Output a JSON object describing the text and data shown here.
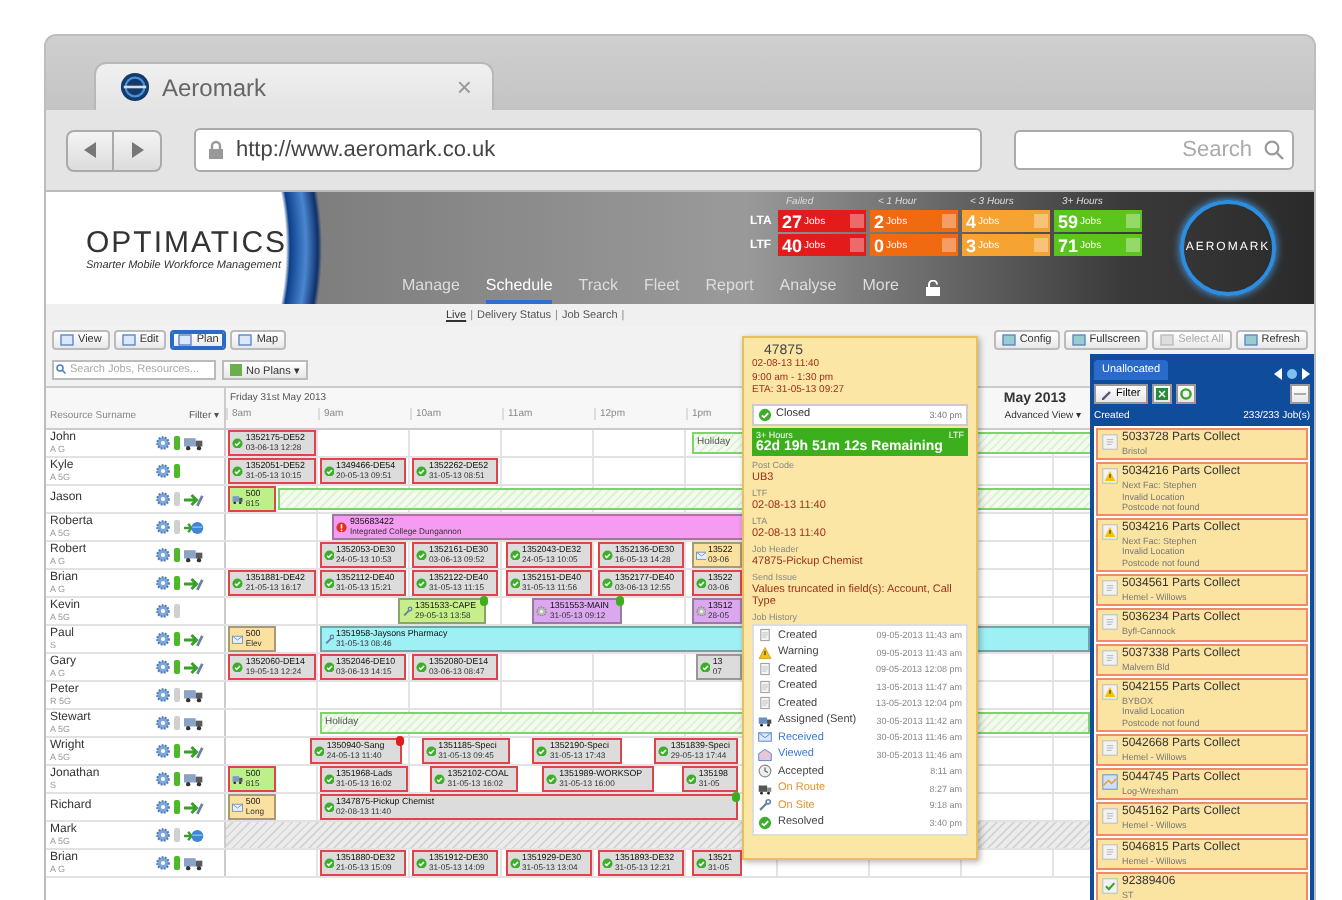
{
  "browser": {
    "tab": {
      "title": "Aeromark",
      "close": "×"
    },
    "url": "http://www.aeromark.co.uk",
    "search": {
      "placeholder": "Search"
    }
  },
  "header": {
    "logo": {
      "name": "OPTIMATICS",
      "tagline": "Smarter Mobile Workforce Management"
    },
    "brand": "AEROMARK",
    "stats": {
      "columns": [
        "Failed",
        "< 1 Hour",
        "< 3 Hours",
        "3+ Hours"
      ],
      "rows": [
        {
          "label": "LTA",
          "cells": [
            {
              "count": "27",
              "unit": "Jobs",
              "color": "#e31b1b"
            },
            {
              "count": "2",
              "unit": "Jobs",
              "color": "#f06a12"
            },
            {
              "count": "4",
              "unit": "Jobs",
              "color": "#f5a332"
            },
            {
              "count": "59",
              "unit": "Jobs",
              "color": "#5cc51d"
            }
          ]
        },
        {
          "label": "LTF",
          "cells": [
            {
              "count": "40",
              "unit": "Jobs",
              "color": "#e31b1b"
            },
            {
              "count": "0",
              "unit": "Jobs",
              "color": "#f06a12"
            },
            {
              "count": "3",
              "unit": "Jobs",
              "color": "#f5a332"
            },
            {
              "count": "71",
              "unit": "Jobs",
              "color": "#5cc51d"
            }
          ]
        }
      ]
    },
    "nav": [
      {
        "label": "Manage",
        "selected": false
      },
      {
        "label": "Schedule",
        "selected": true
      },
      {
        "label": "Track",
        "selected": false
      },
      {
        "label": "Fleet",
        "selected": false
      },
      {
        "label": "Report",
        "selected": false
      },
      {
        "label": "Analyse",
        "selected": false
      },
      {
        "label": "More",
        "selected": false
      }
    ],
    "subnav": [
      {
        "label": "Live",
        "selected": true,
        "separator": "|"
      },
      {
        "label": "Delivery Status",
        "selected": false,
        "separator": "|"
      },
      {
        "label": "Job Search",
        "selected": false,
        "separator": "|"
      }
    ]
  },
  "toolbar": {
    "views": [
      {
        "label": "View",
        "selected": false
      },
      {
        "label": "Edit",
        "selected": false
      },
      {
        "label": "Plan",
        "selected": true
      },
      {
        "label": "Map",
        "selected": false
      }
    ],
    "actions": [
      {
        "label": "Config",
        "disabled": false
      },
      {
        "label": "Fullscreen",
        "disabled": false
      },
      {
        "label": "Select All",
        "disabled": true
      },
      {
        "label": "Refresh",
        "disabled": false
      }
    ]
  },
  "search": {
    "placeholder": "Search Jobs, Resources...",
    "plans": "No Plans ▾"
  },
  "schedule": {
    "date": "Friday 31st May 2013",
    "resource_header": "Resource Surname",
    "filter": "Filter ▾",
    "month": "May 2013",
    "view": "Advanced View ▾",
    "hours": [
      "8am",
      "9am",
      "10am",
      "11am",
      "12pm",
      "1pm"
    ],
    "rows": [
      {
        "name": "John",
        "sub": "A G",
        "phone": true,
        "kind": "truck",
        "jobs": [
          {
            "kind": "check",
            "color": "#dcdcdc",
            "late": true,
            "id": "1352175-DE52",
            "time": "03-06-13 12:28"
          },
          {
            "kind": "holiday",
            "label": "Holiday"
          }
        ]
      },
      {
        "name": "Kyle",
        "sub": "A 5G",
        "phone": true,
        "kind": "none",
        "jobs": [
          {
            "kind": "check",
            "color": "#dcdcdc",
            "late": true,
            "id": "1352051-DE52",
            "time": "31-05-13 10:15"
          },
          {
            "kind": "check",
            "color": "#dcdcdc",
            "late": true,
            "id": "1349466-DE54",
            "time": "20-05-13 09:51"
          },
          {
            "kind": "check",
            "color": "#dcdcdc",
            "late": true,
            "id": "1352262-DE52",
            "time": "31-05-13 08:51"
          }
        ]
      },
      {
        "name": "Jason",
        "phone": false,
        "kind": "arrow",
        "jobs": [
          {
            "kind": "truck",
            "color": "#bdf08a",
            "late": true,
            "id": "500",
            "time": "815"
          },
          {
            "kind": "holiday"
          }
        ]
      },
      {
        "name": "Roberta",
        "sub": "A 5G",
        "phone": false,
        "kind": "globe",
        "jobs": [
          {
            "kind": "alert",
            "color": "#f59cf2",
            "late": false,
            "id": "935683422",
            "time": "Integrated College Dungannon"
          }
        ]
      },
      {
        "name": "Robert",
        "sub": "A G",
        "phone": true,
        "kind": "truck",
        "jobs": [
          {
            "kind": "check",
            "color": "#dcdcdc",
            "late": true,
            "id": "1352053-DE30",
            "time": "24-05-13 10:53"
          },
          {
            "kind": "check",
            "color": "#dcdcdc",
            "late": true,
            "id": "1352161-DE30",
            "time": "03-06-13 09:52"
          },
          {
            "kind": "check",
            "color": "#dcdcdc",
            "late": true,
            "id": "1352043-DE32",
            "time": "24-05-13 10:05"
          },
          {
            "kind": "check",
            "color": "#dcdcdc",
            "late": true,
            "id": "1352136-DE30",
            "time": "16-05-13 14:28"
          },
          {
            "kind": "mail",
            "color": "#fbe1a0",
            "late": false,
            "id": "13522",
            "time": "03-06"
          }
        ]
      },
      {
        "name": "Brian",
        "sub": "A G",
        "phone": true,
        "kind": "arrow",
        "jobs": [
          {
            "kind": "check",
            "color": "#dcdcdc",
            "late": true,
            "id": "1351881-DE42",
            "time": "21-05-13 16:17"
          },
          {
            "kind": "check",
            "color": "#dcdcdc",
            "late": true,
            "id": "1352112-DE40",
            "time": "31-05-13 15:21"
          },
          {
            "kind": "check",
            "color": "#dcdcdc",
            "late": true,
            "id": "1352122-DE40",
            "time": "31-05-13 11:15"
          },
          {
            "kind": "check",
            "color": "#dcdcdc",
            "late": true,
            "id": "1352151-DE40",
            "time": "31-05-13 11:56"
          },
          {
            "kind": "check",
            "color": "#dcdcdc",
            "late": true,
            "id": "1352177-DE40",
            "time": "03-06-13 12:55"
          },
          {
            "kind": "check",
            "color": "#dcdcdc",
            "late": true,
            "id": "13522",
            "time": "03-06"
          }
        ]
      },
      {
        "name": "Kevin",
        "sub": "A 5G",
        "phone": false,
        "kind": "none",
        "jobs": [
          {
            "kind": "wrench",
            "color": "#c6ef8c",
            "late": false,
            "id": "1351533-CAPE",
            "time": "29-05-13 13:58",
            "badge": {
              "color": "#3cb01c"
            }
          },
          {
            "kind": "gear",
            "color": "#dba8f0",
            "late": false,
            "id": "1351553-MAIN",
            "time": "31-05-13 09:12",
            "badge": {
              "color": "#3cb01c"
            }
          },
          {
            "kind": "gear",
            "color": "#dba8f0",
            "late": false,
            "id": "13512",
            "time": "28-05"
          }
        ]
      },
      {
        "name": "Paul",
        "sub": "S",
        "phone": true,
        "kind": "arrow",
        "jobs": [
          {
            "kind": "mail",
            "color": "#fbe1a0",
            "late": false,
            "id": "500",
            "time": "Elev"
          },
          {
            "kind": "wrench",
            "color": "#9ff0f4",
            "late": false,
            "id": "1351958-Jaysons Pharmacy",
            "time": "31-05-13 08:46"
          }
        ]
      },
      {
        "name": "Gary",
        "sub": "A G",
        "phone": true,
        "kind": "arrow",
        "jobs": [
          {
            "kind": "check",
            "color": "#dcdcdc",
            "late": true,
            "id": "1352060-DE14",
            "time": "19-05-13 12:24"
          },
          {
            "kind": "check",
            "color": "#dcdcdc",
            "late": true,
            "id": "1352046-DE10",
            "time": "03-06-13 14:15"
          },
          {
            "kind": "check",
            "color": "#dcdcdc",
            "late": true,
            "id": "1352080-DE14",
            "time": "03-06-13 08:47"
          },
          {
            "kind": "check",
            "color": "#dcdcdc",
            "late": false,
            "id": "13",
            "time": "07"
          }
        ]
      },
      {
        "name": "Peter",
        "sub": "R 5G",
        "phone": false,
        "kind": "truck",
        "jobs": []
      },
      {
        "name": "Stewart",
        "sub": "A 5G",
        "phone": false,
        "kind": "truck",
        "jobs": [
          {
            "kind": "holiday",
            "label": "Holiday"
          }
        ]
      },
      {
        "name": "Wright",
        "sub": "A 5G",
        "phone": true,
        "kind": "arrow",
        "jobs": [
          {
            "kind": "check",
            "color": "#dcdcdc",
            "late": true,
            "id": "1350940-Sang",
            "time": "24-05-13 11:40",
            "badge": {
              "color": "#e31b1b"
            }
          },
          {
            "kind": "check",
            "color": "#dcdcdc",
            "late": true,
            "id": "1351185-Speci",
            "time": "31-05-13 09:45"
          },
          {
            "kind": "check",
            "color": "#dcdcdc",
            "late": true,
            "id": "1352190-Speci",
            "time": "31-05-13 17:43"
          },
          {
            "kind": "check",
            "color": "#dcdcdc",
            "late": true,
            "id": "1351839-Speci",
            "time": "29-05-13 17:44"
          }
        ]
      },
      {
        "name": "Jonathan",
        "sub": "S",
        "phone": true,
        "kind": "truck",
        "jobs": [
          {
            "kind": "truck",
            "color": "#bdf08a",
            "late": true,
            "id": "500",
            "time": "815"
          },
          {
            "kind": "check",
            "color": "#dcdcdc",
            "late": true,
            "id": "1351968-Lads",
            "time": "31-05-13 16:02"
          },
          {
            "kind": "check",
            "color": "#dcdcdc",
            "late": true,
            "id": "1352102-COAL",
            "time": "31-05-13 16:02"
          },
          {
            "kind": "check",
            "color": "#dcdcdc",
            "late": true,
            "id": "1351989-WORKSOP",
            "time": "31-05-13 16:00"
          },
          {
            "kind": "check",
            "color": "#dcdcdc",
            "late": true,
            "id": "135198",
            "time": "31-05"
          }
        ]
      },
      {
        "name": "Richard",
        "phone": true,
        "kind": "arrow",
        "jobs": [
          {
            "kind": "mail",
            "color": "#fbe1a0",
            "late": false,
            "id": "500",
            "time": "Long"
          },
          {
            "kind": "check",
            "color": "#dcdcdc",
            "late": true,
            "id": "1347875-Pickup Chemist",
            "time": "02-08-13 11:40",
            "badge": {
              "color": "#3cb01c"
            }
          }
        ]
      },
      {
        "name": "Mark",
        "sub": "A 5G",
        "phone": false,
        "kind": "globe",
        "jobs": [
          {
            "kind": "blocked"
          }
        ]
      },
      {
        "name": "Brian",
        "sub": "A G",
        "phone": true,
        "kind": "truck",
        "jobs": [
          {
            "kind": "check",
            "color": "#dcdcdc",
            "late": true,
            "id": "1351880-DE32",
            "time": "21-05-13 15:09"
          },
          {
            "kind": "check",
            "color": "#dcdcdc",
            "late": true,
            "id": "1351912-DE30",
            "time": "31-05-13 14:09"
          },
          {
            "kind": "check",
            "color": "#dcdcdc",
            "late": true,
            "id": "1351929-DE30",
            "time": "31-05-13 13:04"
          },
          {
            "kind": "check",
            "color": "#dcdcdc",
            "late": true,
            "id": "1351893-DE32",
            "time": "31-05-13 12:21"
          },
          {
            "kind": "check",
            "color": "#dcdcdc",
            "late": true,
            "id": "13521",
            "time": "31-05"
          }
        ]
      }
    ]
  },
  "tooltip": {
    "job": "47875",
    "lines": [
      "02-08-13 11:40",
      "9:00 am - 1:30 pm",
      "ETA: 31-05-13 09:27"
    ],
    "status": {
      "label": "Closed",
      "time": "3:40 pm"
    },
    "sla": {
      "band": "3+ Hours",
      "type": "LTF",
      "remaining": "62d 19h 51m 12s Remaining"
    },
    "fields": [
      {
        "label": "Post Code",
        "value": "UB3"
      },
      {
        "label": "LTF",
        "value": "02-08-13 11:40"
      },
      {
        "label": "LTA",
        "value": "02-08-13 11:40"
      },
      {
        "label": "Job Header",
        "value": "47875-Pickup Chemist"
      },
      {
        "label": "Send Issue",
        "value": "Values truncated in field(s): Account, Call Type"
      }
    ],
    "history_title": "Job History",
    "history": [
      {
        "kind": "created",
        "label": "Created",
        "time": "09-05-2013 11:43 am"
      },
      {
        "kind": "warning",
        "label": "Warning",
        "time": "09-05-2013 11:43 am"
      },
      {
        "kind": "created",
        "label": "Created",
        "time": "09-05-2013 12:08 pm"
      },
      {
        "kind": "created",
        "label": "Created",
        "time": "13-05-2013 11:47 am"
      },
      {
        "kind": "created",
        "label": "Created",
        "time": "13-05-2013 12:04 pm"
      },
      {
        "kind": "assigned",
        "label": "Assigned (Sent)",
        "time": "30-05-2013 11:42 am"
      },
      {
        "kind": "received",
        "label": "Received",
        "time": "30-05-2013 11:46 am"
      },
      {
        "kind": "viewed",
        "label": "Viewed",
        "time": "30-05-2013 11:46 am"
      },
      {
        "kind": "accepted",
        "label": "Accepted",
        "time": "8:11 am"
      },
      {
        "kind": "onroute",
        "label": "On Route",
        "time": "8:27 am"
      },
      {
        "kind": "onsite",
        "label": "On Site",
        "time": "9:18 am"
      },
      {
        "kind": "resolved",
        "label": "Resolved",
        "time": "3:40 pm"
      }
    ]
  },
  "unallocated": {
    "tab": "Unallocated",
    "filter": "Filter",
    "sort": "Created",
    "count": "233/233 Job(s)",
    "items": [
      {
        "kind": "doc",
        "title": "5033728 Parts Collect",
        "lines": [
          "Bristol"
        ]
      },
      {
        "kind": "warning",
        "title": "5034216 Parts Collect",
        "lines": [
          "Next Fac: Stephen",
          "Invalid Location",
          "Postcode not found"
        ]
      },
      {
        "kind": "warning",
        "title": "5034216 Parts Collect",
        "lines": [
          "Next Fac: Stephen",
          "Invalid Location",
          "Postcode not found"
        ]
      },
      {
        "kind": "doc",
        "title": "5034561 Parts Collect",
        "lines": [
          "Hemel - Willows"
        ]
      },
      {
        "kind": "doc",
        "title": "5036234 Parts Collect",
        "lines": [
          "Byfl-Cannock"
        ]
      },
      {
        "kind": "doc",
        "title": "5037338 Parts Collect",
        "lines": [
          "Malvern Bld"
        ]
      },
      {
        "kind": "warning",
        "title": "5042155 Parts Collect",
        "lines": [
          "BYBOX",
          "Invalid Location",
          "Postcode not found"
        ]
      },
      {
        "kind": "doc",
        "title": "5042668 Parts Collect",
        "lines": [
          "Hemel - Willows"
        ]
      },
      {
        "kind": "map",
        "title": "5044745 Parts Collect",
        "lines": [
          "Log-Wrexham"
        ]
      },
      {
        "kind": "doc",
        "title": "5045162 Parts Collect",
        "lines": [
          "Hemel - Willows"
        ]
      },
      {
        "kind": "doc",
        "title": "5046815 Parts Collect",
        "lines": [
          "Hemel - Willows"
        ]
      },
      {
        "kind": "check",
        "title": "92389406",
        "lines": [
          "ST"
        ]
      }
    ]
  }
}
